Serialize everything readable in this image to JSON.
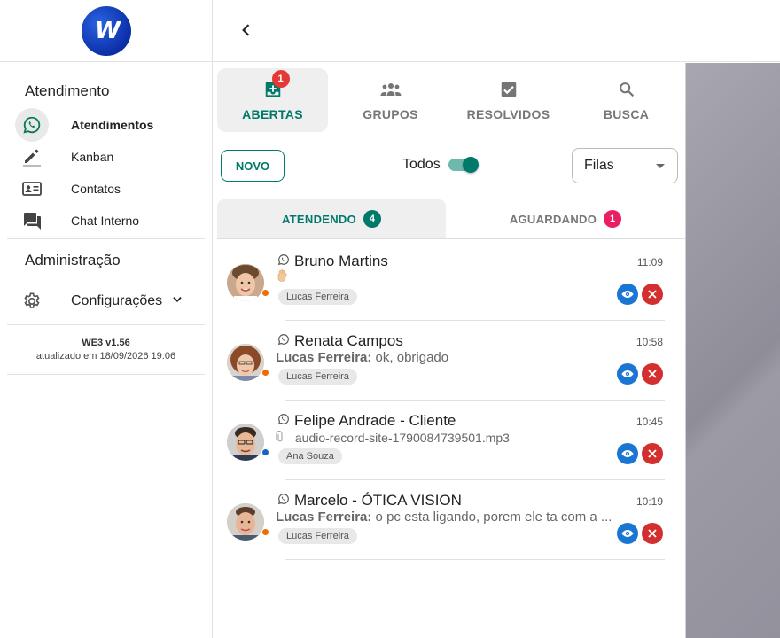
{
  "sidebar": {
    "logo_text": "W",
    "section_atendimento": "Atendimento",
    "items": [
      {
        "label": "Atendimentos",
        "icon": "whatsapp-icon"
      },
      {
        "label": "Kanban",
        "icon": "pencil-icon"
      },
      {
        "label": "Contatos",
        "icon": "contacts-icon"
      },
      {
        "label": "Chat Interno",
        "icon": "chat-icon"
      }
    ],
    "section_admin": "Administração",
    "config_label": "Configurações",
    "version": "WE3 v1.56",
    "updated": "atualizado em 18/09/2026 19:06"
  },
  "tabs": [
    {
      "label": "ABERTAS",
      "icon": "inbox-icon",
      "badge": "1"
    },
    {
      "label": "GRUPOS",
      "icon": "groups-icon"
    },
    {
      "label": "RESOLVIDOS",
      "icon": "checkbox-icon"
    },
    {
      "label": "BUSCA",
      "icon": "search-icon"
    }
  ],
  "toolbar": {
    "novo_label": "NOVO",
    "todos_label": "Todos",
    "todos_on": true,
    "filas_value": "Filas"
  },
  "subtabs": [
    {
      "label": "ATENDENDO",
      "count": "4"
    },
    {
      "label": "AGUARDANDO",
      "count": "1"
    }
  ],
  "tickets": [
    {
      "name": "Bruno Martins",
      "time": "11:09",
      "sender": "",
      "message": "",
      "message_icon": "hand-icon",
      "tag": "Lucas Ferreira",
      "status_color": "#ef6c00"
    },
    {
      "name": "Renata Campos",
      "time": "10:58",
      "sender": "Lucas Ferreira:",
      "message": " ok, obrigado",
      "tag": "Lucas Ferreira",
      "status_color": "#ef6c00"
    },
    {
      "name": "Felipe Andrade - Cliente",
      "time": "10:45",
      "sender": "",
      "message": "audio-record-site-1790084739501.mp3",
      "message_icon": "paperclip-icon",
      "tag": "Ana Souza",
      "status_color": "#1565c0"
    },
    {
      "name": "Marcelo - ÓTICA VISION",
      "time": "10:19",
      "sender": "Lucas Ferreira:",
      "message": " o pc esta ligando, porem ele ta com a ...",
      "tag": "Lucas Ferreira",
      "status_color": "#ef6c00"
    }
  ],
  "colors": {
    "accent": "#00796b",
    "badge_red": "#e53935",
    "badge_pink": "#e91e63",
    "view_blue": "#1976d2",
    "close_red": "#d32f2f"
  }
}
